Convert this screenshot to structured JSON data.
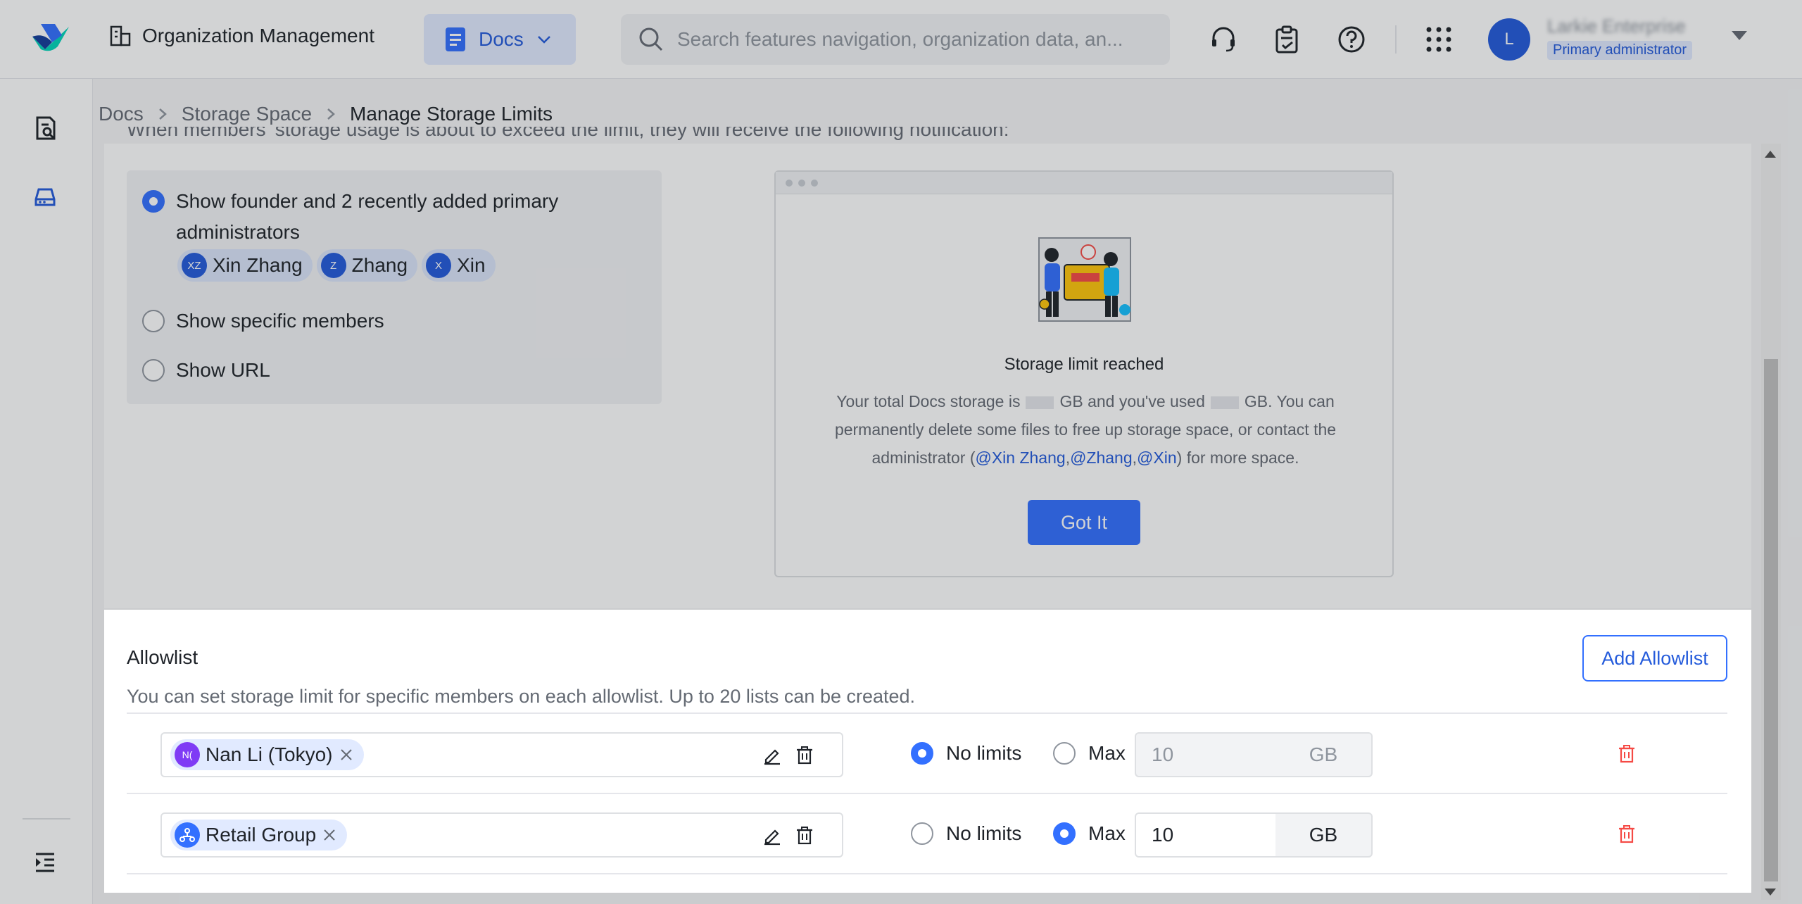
{
  "header": {
    "org_title": "Organization Management",
    "product_switch": "Docs",
    "search_placeholder": "Search features navigation, organization data, an...",
    "user_initial": "L",
    "user_name": "Larkie Enterprise",
    "user_role": "Primary administrator"
  },
  "breadcrumb": [
    "Docs",
    "Storage Space",
    "Manage Storage Limits"
  ],
  "notification": {
    "cut_text": "When members' storage usage is about to exceed the limit, they will receive the following notification:",
    "options": [
      {
        "label": "Show founder and 2 recently added primary administrators",
        "selected": true
      },
      {
        "label": "Show specific members",
        "selected": false
      },
      {
        "label": "Show URL",
        "selected": false
      }
    ],
    "admins": [
      {
        "initials": "XZ",
        "name": "Xin Zhang"
      },
      {
        "initials": "Z",
        "name": "Zhang"
      },
      {
        "initials": "X",
        "name": "Xin"
      }
    ]
  },
  "preview": {
    "title": "Storage limit reached",
    "body_1": "Your total Docs storage is",
    "body_2": "GB and you've used",
    "body_3": "GB. You can",
    "body_4": "permanently delete some files to free up storage space, or contact the",
    "body_5": "administrator (",
    "mention_1": "@Xin Zhang",
    "mention_2": "@Zhang",
    "mention_3": "@Xin",
    "comma": ",",
    "body_6": ") for more space.",
    "button": "Got It"
  },
  "allowlist": {
    "title": "Allowlist",
    "description": "You can set storage limit for specific members on each allowlist. Up to 20 lists can be created.",
    "add_button": "Add Allowlist",
    "no_limits_label": "No limits",
    "max_label": "Max",
    "unit": "GB",
    "rows": [
      {
        "member": "Nan Li (Tokyo)",
        "avatar": "N(",
        "avatar_color": "#7f3bf5",
        "limit_mode": "no_limits",
        "max_value": "10"
      },
      {
        "member": "Retail Group",
        "avatar": "group-icon",
        "avatar_color": "#3370ff",
        "limit_mode": "max",
        "max_value": "10"
      }
    ]
  },
  "colors": {
    "accent": "#3370ff",
    "danger": "#f54a45"
  }
}
